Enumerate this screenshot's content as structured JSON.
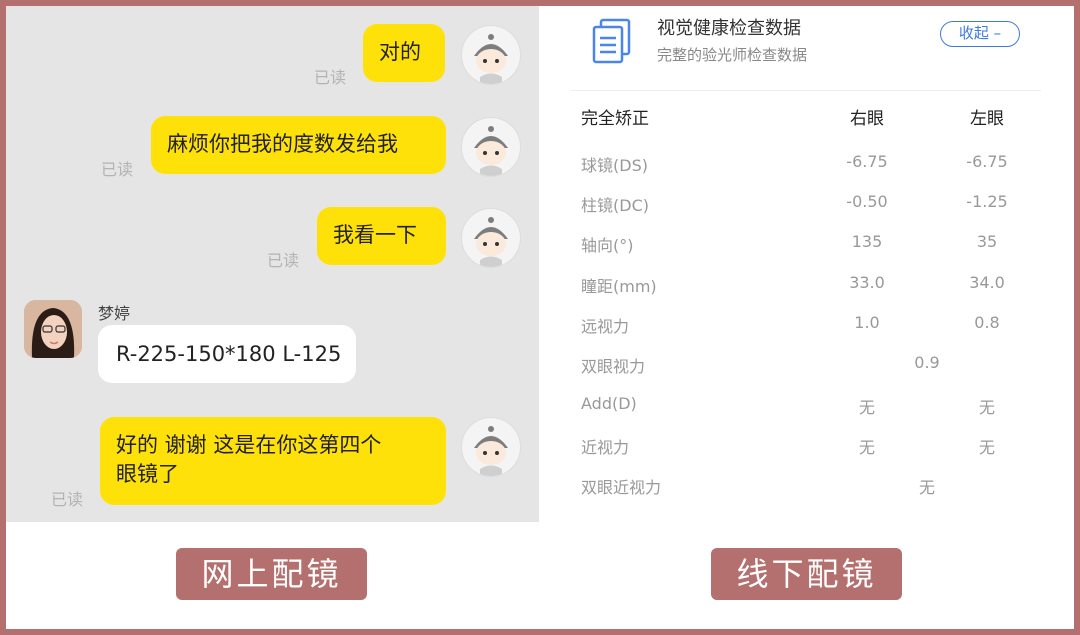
{
  "chat": {
    "messages": [
      {
        "text": "对的",
        "status": "已读"
      },
      {
        "text": "麻烦你把我的度数发给我",
        "status": "已读"
      },
      {
        "text": "我看一下",
        "status": "已读"
      },
      {
        "sender": "梦婷",
        "text": "R-225-150*180 L-125"
      },
      {
        "line1": "好的  谢谢 这是在你这第四个",
        "line2": "眼镜了",
        "status": "已读"
      }
    ]
  },
  "exam": {
    "title": "视觉健康检查数据",
    "subtitle": "完整的验光师检查数据",
    "collapse_label": "收起 –",
    "header": {
      "label": "完全矫正",
      "right": "右眼",
      "left": "左眼"
    },
    "rows": [
      {
        "label": "球镜(DS)",
        "right": "-6.75",
        "left": "-6.75"
      },
      {
        "label": "柱镜(DC)",
        "right": "-0.50",
        "left": "-1.25"
      },
      {
        "label": "轴向(°)",
        "right": "135",
        "left": "35"
      },
      {
        "label": "瞳距(mm)",
        "right": "33.0",
        "left": "34.0"
      },
      {
        "label": "远视力",
        "right": "1.0",
        "left": "0.8"
      },
      {
        "label": "双眼视力",
        "both": "0.9"
      },
      {
        "label": "Add(D)",
        "right": "无",
        "left": "无"
      },
      {
        "label": "近视力",
        "right": "无",
        "left": "无"
      },
      {
        "label": "双眼近视力",
        "both": "无"
      }
    ]
  },
  "captions": {
    "left": "网上配镜",
    "right": "线下配镜"
  },
  "colors": {
    "frame": "#b4706e",
    "bubble": "#ffe10a",
    "accent": "#3d7be0"
  }
}
